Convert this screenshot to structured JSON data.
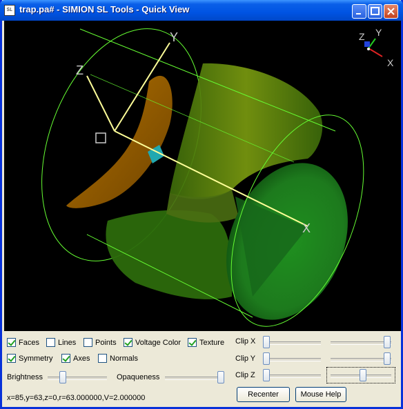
{
  "window": {
    "title": "trap.pa# - SIMION SL Tools - Quick View",
    "icon_text": "SL"
  },
  "viewport": {
    "axis_labels": {
      "x": "X",
      "y": "Y",
      "z": "Z"
    },
    "gizmo_labels": {
      "x": "X",
      "y": "Y",
      "z": "Z"
    },
    "colors": {
      "background": "#000000",
      "wire": "#66ff33",
      "axis": "#ffff99",
      "electrode_green": "#2a8a2a",
      "electrode_orange": "#b86a00",
      "marker": "#20a8b0"
    }
  },
  "options": {
    "faces": {
      "label": "Faces",
      "checked": true
    },
    "lines": {
      "label": "Lines",
      "checked": false
    },
    "points": {
      "label": "Points",
      "checked": false
    },
    "voltage_color": {
      "label": "Voltage Color",
      "checked": true
    },
    "texture": {
      "label": "Texture",
      "checked": true
    },
    "symmetry": {
      "label": "Symmetry",
      "checked": true
    },
    "axes": {
      "label": "Axes",
      "checked": true
    },
    "normals": {
      "label": "Normals",
      "checked": false
    }
  },
  "sliders": {
    "brightness": {
      "label": "Brightness",
      "value": 0.25
    },
    "opaqueness": {
      "label": "Opaqueness",
      "value": 1.0
    },
    "clip_x": {
      "label": "Clip X",
      "low": 0.0,
      "high": 1.0
    },
    "clip_y": {
      "label": "Clip Y",
      "low": 0.0,
      "high": 1.0
    },
    "clip_z": {
      "label": "Clip Z",
      "low": 0.0,
      "high": 0.55
    }
  },
  "buttons": {
    "recenter": "Recenter",
    "mouse_help": "Mouse Help"
  },
  "status": "x=85,y=63,z=0,r=63.000000,V=2.000000"
}
